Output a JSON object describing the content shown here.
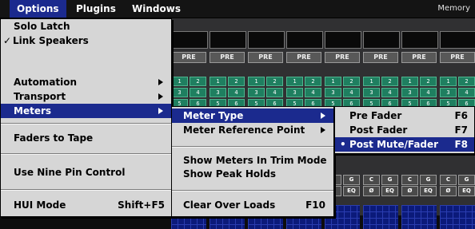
{
  "menubar": {
    "items": [
      {
        "label": "Options",
        "active": true
      },
      {
        "label": "Plugins",
        "active": false
      },
      {
        "label": "Windows",
        "active": false
      }
    ],
    "right_label": "Memory"
  },
  "options_menu": {
    "items": [
      {
        "label": "Solo Latch",
        "checked": false
      },
      {
        "label": "Link Speakers",
        "checked": true,
        "check_glyph": "✓"
      },
      {
        "label": "Automation",
        "submenu": true
      },
      {
        "label": "Transport",
        "submenu": true
      },
      {
        "label": "Meters",
        "submenu": true,
        "highlighted": true
      },
      {
        "label": "Faders to Tape"
      },
      {
        "label": "Use Nine Pin Control"
      },
      {
        "label": "HUI Mode",
        "shortcut": "Shift+F5"
      }
    ]
  },
  "meters_menu": {
    "items": [
      {
        "label": "Meter Type",
        "submenu": true,
        "highlighted": true
      },
      {
        "label": "Meter Reference Point",
        "submenu": true
      },
      {
        "label": "Show Meters In Trim Mode"
      },
      {
        "label": "Show Peak Holds"
      },
      {
        "label": "Clear Over Loads",
        "shortcut": "F10"
      }
    ]
  },
  "meter_type_menu": {
    "items": [
      {
        "label": "Pre Fader",
        "shortcut": "F6"
      },
      {
        "label": "Post Fader",
        "shortcut": "F7"
      },
      {
        "label": "Post Mute/Fader",
        "shortcut": "F8",
        "selected": true,
        "selected_glyph": "•"
      }
    ]
  },
  "mixer": {
    "pre_label": "PRE",
    "voice_rows": [
      [
        "1",
        "2"
      ],
      [
        "3",
        "4"
      ],
      [
        "5",
        "6"
      ],
      [
        "7",
        "8"
      ]
    ],
    "cg_labels": [
      "C",
      "G"
    ],
    "eq_labels": [
      "Ø",
      "EQ"
    ]
  },
  "colors": {
    "menu_highlight": "#1b2a8e",
    "menu_bg": "#d6d6d6",
    "voice_green": "#1f7f60",
    "meter_blue": "#0b1a7a"
  }
}
